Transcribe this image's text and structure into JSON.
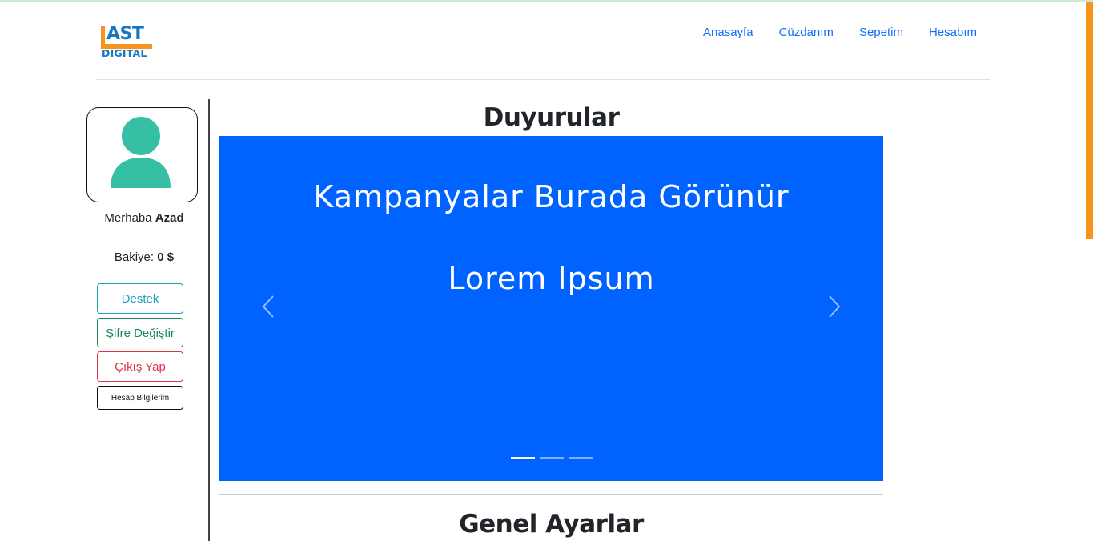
{
  "brand": {
    "logo_top": "AST",
    "logo_bottom": "DIGITAL",
    "logo_color": "#1a77c2",
    "logo_accent": "#f7941d",
    "logo_text": "LAST DIGITAL"
  },
  "nav": {
    "items": [
      {
        "label": "Anasayfa"
      },
      {
        "label": "Cüzdanım"
      },
      {
        "label": "Sepetim"
      },
      {
        "label": "Hesabım"
      }
    ],
    "link_color": "#0d6efd"
  },
  "sidebar": {
    "avatar_icon": "user-avatar-icon",
    "avatar_color": "#35bfa4",
    "greeting_prefix": "Merhaba",
    "username": "Azad",
    "balance_label": "Bakiye:",
    "balance_value": "0 $",
    "buttons": {
      "destek": "Destek",
      "sifre": "Şifre Değiştir",
      "cikis": "Çıkış Yap",
      "hesap": "Hesap Bilgilerim"
    }
  },
  "main": {
    "announcements_title": "Duyurular",
    "carousel": {
      "headline": "Kampanyalar Burada Görünür",
      "subline": "Lorem Ipsum",
      "background": "#0062ff",
      "prev_icon": "chevron-left-icon",
      "next_icon": "chevron-right-icon",
      "slide_count": 3,
      "active_index": 0
    },
    "settings_title": "Genel Ayarlar"
  }
}
